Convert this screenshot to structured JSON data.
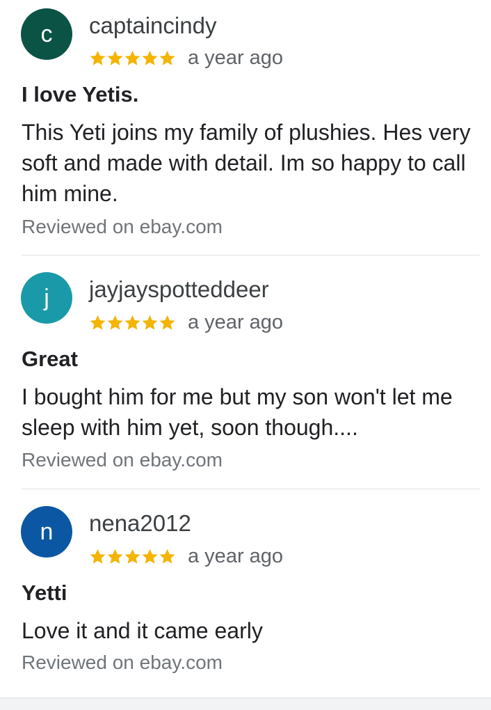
{
  "colors": {
    "star": "#f4b400",
    "text_primary": "#202124",
    "text_secondary": "#70757a"
  },
  "reviews": [
    {
      "avatar_letter": "c",
      "avatar_color": "#0b5345",
      "username": "captaincindy",
      "rating": 5,
      "time": "a year ago",
      "title": "I love Yetis.",
      "body": "This Yeti joins my family of plushies. Hes very soft and made with detail. Im so happy to call him mine.",
      "source": "Reviewed on ebay.com"
    },
    {
      "avatar_letter": "j",
      "avatar_color": "#1a9aa8",
      "username": "jayjayspotteddeer",
      "rating": 5,
      "time": "a year ago",
      "title": "Great",
      "body": "I bought him for me but my son won't let me sleep with him yet, soon though....",
      "source": "Reviewed on ebay.com"
    },
    {
      "avatar_letter": "n",
      "avatar_color": "#0b57a4",
      "username": "nena2012",
      "rating": 5,
      "time": "a year ago",
      "title": "Yetti",
      "body": "Love it and it came early",
      "source": "Reviewed on ebay.com"
    }
  ]
}
